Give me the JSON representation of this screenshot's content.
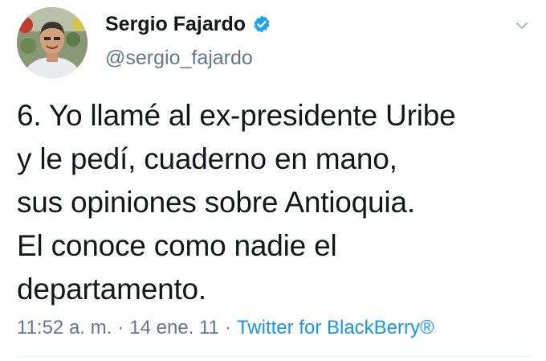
{
  "tweet": {
    "author": {
      "display_name": "Sergio Fajardo",
      "handle": "@sergio_fajardo",
      "verified": true
    },
    "text_lines": [
      "6. Yo llamé al ex-presidente Uribe",
      "y le pedí, cuaderno en mano,",
      "sus opiniones sobre Antioquia.",
      "El conoce como nadie el",
      "departamento."
    ],
    "time": "11:52 a. m.",
    "separator": "·",
    "date": "14 ene. 11",
    "source": "Twitter for BlackBerry®"
  },
  "icons": {
    "verified": "verified-badge-icon",
    "menu": "chevron-down-icon"
  },
  "colors": {
    "text": "#14171a",
    "secondary": "#657786",
    "link": "#1b95e0",
    "verified": "#1da1f2",
    "divider": "#e6ecf0"
  }
}
